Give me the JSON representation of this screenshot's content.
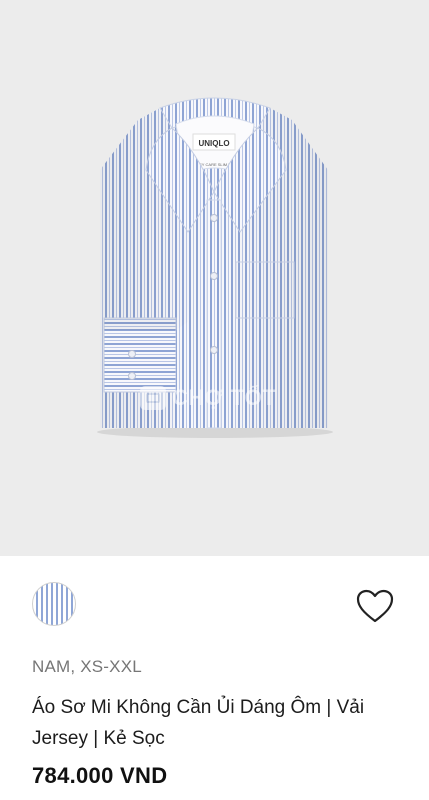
{
  "product": {
    "image_alt": "striped-shirt-photo",
    "brand_tag": "UNIQLO",
    "watermark_text": "CHỢ TỐT",
    "color_swatch": {
      "name": "blue-white-stripe",
      "colors": [
        "#ffffff",
        "#8fa6d6"
      ]
    },
    "category_size": "NAM, XS-XXL",
    "title": "Áo Sơ Mi Không Cần Ủi Dáng Ôm | Vải Jersey | Kẻ Sọc",
    "price": "784.000 VND"
  },
  "icons": {
    "favorite": "heart-icon"
  },
  "colors": {
    "hero_bg": "#ececec",
    "stripe_blue": "#8fa6d6"
  }
}
